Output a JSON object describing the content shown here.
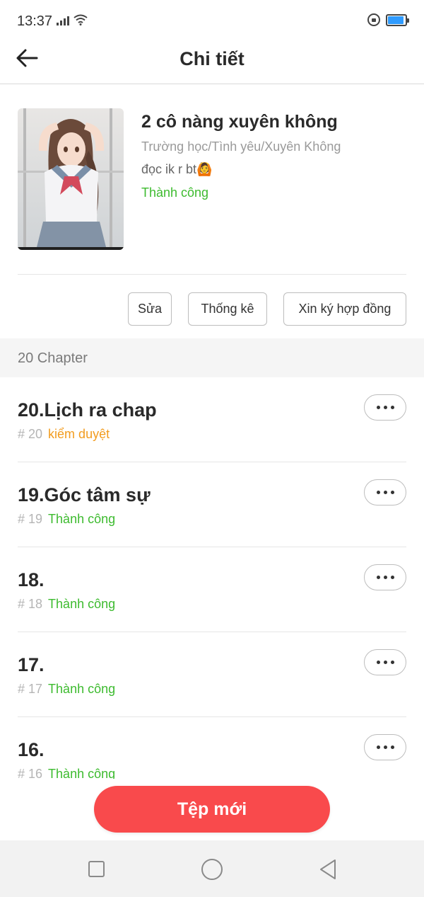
{
  "status_bar": {
    "time": "13:37",
    "battery_level": 0.9,
    "battery_color": "#2f9bff"
  },
  "header": {
    "title": "Chi tiết",
    "back_icon": "arrow-left-icon"
  },
  "story": {
    "title": "2 cô nàng xuyên không",
    "genres": "Trường học/Tình yêu/Xuyên Không",
    "description": "đọc ik r bt🙆",
    "status": "Thành công"
  },
  "actions": {
    "edit": "Sửa",
    "stats": "Thống kê",
    "contract": "Xin ký hợp đồng"
  },
  "chapter_count": "20 Chapter",
  "chapters": [
    {
      "title": "20.Lịch ra chap",
      "number": "# 20",
      "status": "kiểm duyệt",
      "status_type": "pending"
    },
    {
      "title": "19.Góc tâm sự",
      "number": "# 19",
      "status": "Thành công",
      "status_type": "ok"
    },
    {
      "title": "18.",
      "number": "# 18",
      "status": "Thành công",
      "status_type": "ok"
    },
    {
      "title": "17.",
      "number": "# 17",
      "status": "Thành công",
      "status_type": "ok"
    },
    {
      "title": "16.",
      "number": "# 16",
      "status": "Thành công",
      "status_type": "ok"
    }
  ],
  "new_chapter_button": "Tệp mới",
  "colors": {
    "accent": "#f94a4c",
    "success": "#3dbb2f",
    "pending": "#f29c1f"
  },
  "nav_icons": [
    "recent-apps-icon",
    "home-icon",
    "back-triangle-icon"
  ]
}
